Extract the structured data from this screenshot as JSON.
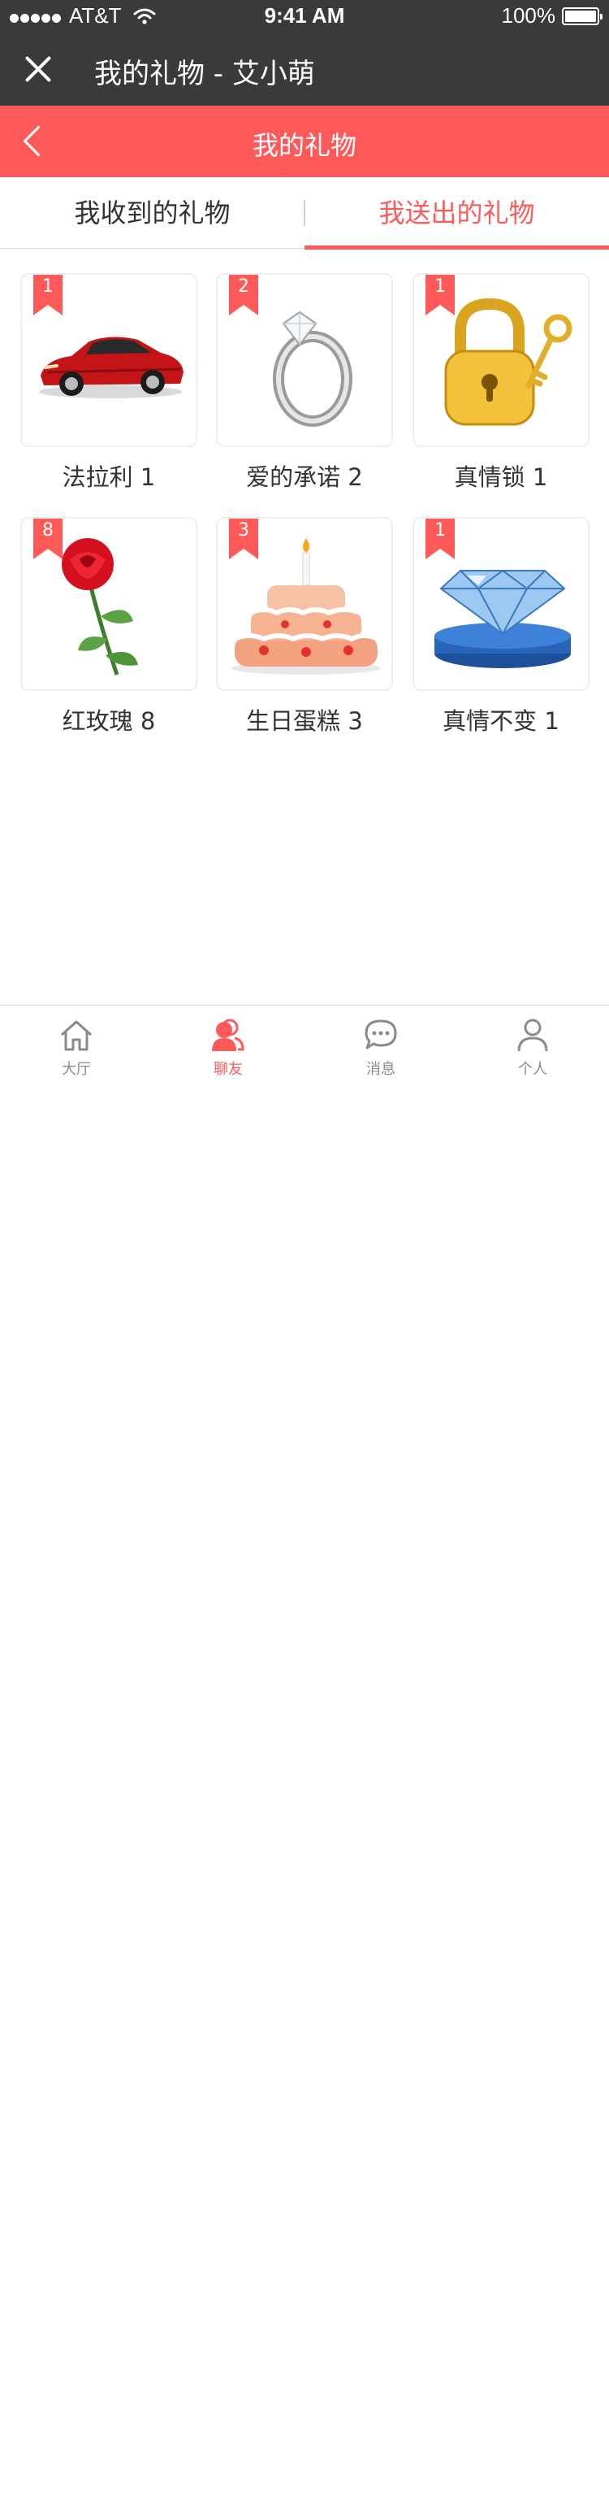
{
  "status_bar": {
    "carrier": "AT&T",
    "time": "9:41 AM",
    "battery": "100%",
    "signal_icon": "signal-dots-icon",
    "wifi_icon": "wifi-icon",
    "battery_icon": "battery-icon"
  },
  "title_bar": {
    "title": "我的礼物 - 艾小萌",
    "close_icon": "close-icon"
  },
  "header": {
    "title": "我的礼物",
    "back_icon": "chevron-left-icon"
  },
  "tabs": [
    {
      "label": "我收到的礼物",
      "active": false
    },
    {
      "label": "我送出的礼物",
      "active": true
    }
  ],
  "gifts": [
    {
      "name": "法拉利",
      "count": "1",
      "label": "法拉利 1",
      "icon": "sports-car-icon"
    },
    {
      "name": "爱的承诺",
      "count": "2",
      "label": "爱的承诺 2",
      "icon": "diamond-ring-icon"
    },
    {
      "name": "真情锁",
      "count": "1",
      "label": "真情锁 1",
      "icon": "padlock-key-icon"
    },
    {
      "name": "红玫瑰",
      "count": "8",
      "label": "红玫瑰 8",
      "icon": "rose-icon"
    },
    {
      "name": "生日蛋糕",
      "count": "3",
      "label": "生日蛋糕 3",
      "icon": "birthday-cake-icon"
    },
    {
      "name": "真情不变",
      "count": "1",
      "label": "真情不变 1",
      "icon": "diamond-icon"
    }
  ],
  "tab_bar": [
    {
      "label": "大厅",
      "icon": "home-icon",
      "active": false
    },
    {
      "label": "聊友",
      "icon": "friends-icon",
      "active": true
    },
    {
      "label": "消息",
      "icon": "message-icon",
      "active": false
    },
    {
      "label": "个人",
      "icon": "person-icon",
      "active": false
    }
  ],
  "colors": {
    "accent": "#ff5a5a",
    "dark_bar": "#3a3a3c",
    "tab_inactive": "#8a8a8a"
  }
}
